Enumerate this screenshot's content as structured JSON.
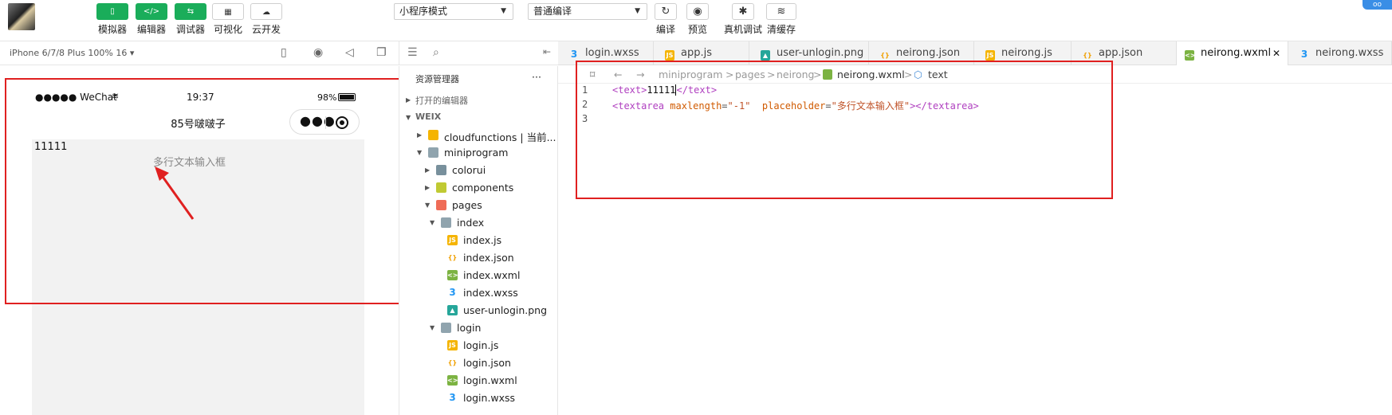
{
  "toolbar": {
    "buttons": [
      {
        "label": "模拟器",
        "icon": "▯"
      },
      {
        "label": "编辑器",
        "icon": "</>"
      },
      {
        "label": "调试器",
        "icon": "⇆"
      },
      {
        "label": "可视化",
        "icon": "▦"
      },
      {
        "label": "云开发",
        "icon": "☁"
      }
    ],
    "mode_select": "小程序模式",
    "compile_select": "普通编译",
    "actions": [
      {
        "label": "编译",
        "icon": "↻"
      },
      {
        "label": "预览",
        "icon": "◉"
      },
      {
        "label": "真机调试",
        "icon": "✱"
      },
      {
        "label": "清缓存",
        "icon": "≋"
      }
    ],
    "corner_badge": "oo"
  },
  "simulator": {
    "device": "iPhone 6/7/8 Plus 100% 16 ▾",
    "status_carrier": "●●●●● WeChat",
    "status_time": "19:37",
    "status_battery": "98%",
    "nav_title": "85号啵啵子",
    "capsule_dots": "●●●",
    "page_text": "11111",
    "textarea_placeholder": "多行文本输入框"
  },
  "explorer": {
    "title": "资源管理器",
    "more": "···",
    "open_editors": "打开的编辑器",
    "root": "WEIX",
    "items": [
      {
        "label": "cloudfunctions | 当前..."
      },
      {
        "label": "miniprogram"
      },
      {
        "label": "colorui"
      },
      {
        "label": "components"
      },
      {
        "label": "pages"
      },
      {
        "label": "index"
      },
      {
        "label": "index.js"
      },
      {
        "label": "index.json"
      },
      {
        "label": "index.wxml"
      },
      {
        "label": "index.wxss"
      },
      {
        "label": "user-unlogin.png"
      },
      {
        "label": "login"
      },
      {
        "label": "login.js"
      },
      {
        "label": "login.json"
      },
      {
        "label": "login.wxml"
      },
      {
        "label": "login.wxss"
      }
    ]
  },
  "tabs": [
    {
      "label": "login.wxss"
    },
    {
      "label": "app.js"
    },
    {
      "label": "user-unlogin.png"
    },
    {
      "label": "neirong.json"
    },
    {
      "label": "neirong.js"
    },
    {
      "label": "app.json"
    },
    {
      "label": "neirong.wxml"
    },
    {
      "label": "neirong.wxss"
    }
  ],
  "tab_close": "✕",
  "breadcrumb": {
    "parts": [
      "miniprogram",
      "pages",
      "neirong",
      "neirong.wxml",
      "text"
    ],
    "sep": ">"
  },
  "code": {
    "line_numbers": [
      "1",
      "2",
      "3"
    ],
    "l1_open": "<text>",
    "l1_text": "11111",
    "l1_close": "</text>",
    "l2_open": "<textarea",
    "l2_attr1": "maxlength",
    "l2_eq": "=",
    "l2_val1": "\"-1\"",
    "l2_attr2": "placeholder",
    "l2_val2": "\"多行文本输入框\"",
    "l2_gt": ">",
    "l2_close": "</textarea>"
  },
  "colors": {
    "accent_green": "#1aad5a",
    "annotation_red": "#e02020",
    "tag_purple": "#b040c0"
  }
}
